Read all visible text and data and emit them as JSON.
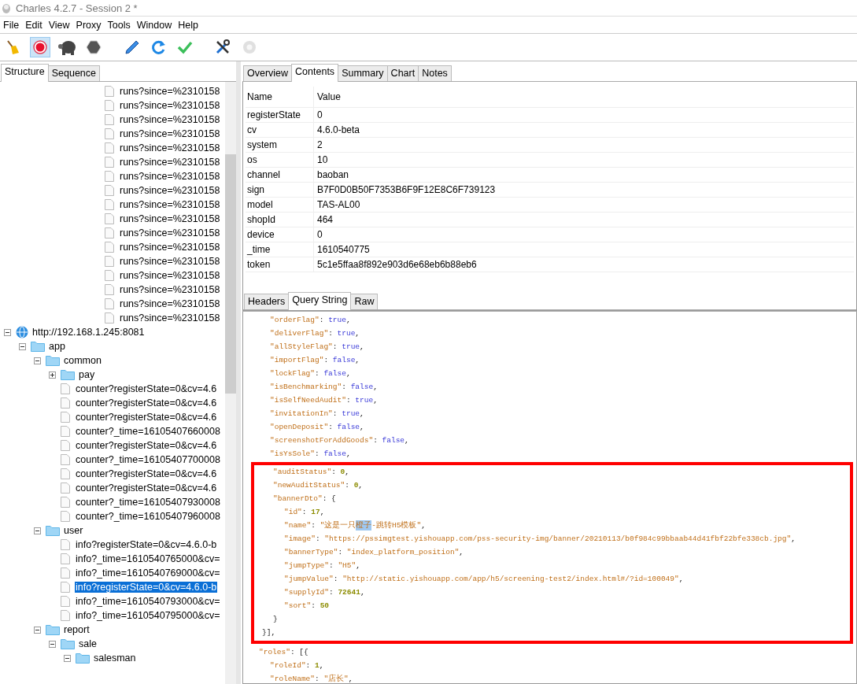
{
  "window": {
    "title": "Charles 4.2.7 - Session 2 *"
  },
  "menu": [
    "File",
    "Edit",
    "View",
    "Proxy",
    "Tools",
    "Window",
    "Help"
  ],
  "toolbar": [
    {
      "kind": "broom",
      "pressed": false,
      "disabled": false
    },
    {
      "kind": "record",
      "pressed": true,
      "disabled": false
    },
    {
      "kind": "turtle",
      "pressed": false,
      "disabled": false
    },
    {
      "kind": "stop",
      "pressed": false,
      "disabled": false
    },
    {
      "kind": "pen",
      "pressed": false,
      "disabled": false
    },
    {
      "kind": "refresh",
      "pressed": false,
      "disabled": false
    },
    {
      "kind": "check",
      "pressed": false,
      "disabled": false
    },
    {
      "kind": "tools",
      "pressed": false,
      "disabled": false
    },
    {
      "kind": "gear",
      "pressed": false,
      "disabled": true
    }
  ],
  "left_tabs": [
    {
      "label": "Structure",
      "selected": true
    },
    {
      "label": "Sequence",
      "selected": false
    }
  ],
  "tree": {
    "scrolled_rows": [
      {
        "label": "runs?since=%2310158",
        "selected": false
      },
      {
        "label": "runs?since=%2310158",
        "selected": false
      },
      {
        "label": "runs?since=%2310158",
        "selected": false
      },
      {
        "label": "runs?since=%2310158",
        "selected": false
      },
      {
        "label": "runs?since=%2310158",
        "selected": false
      },
      {
        "label": "runs?since=%2310158",
        "selected": false
      },
      {
        "label": "runs?since=%2310158",
        "selected": false
      },
      {
        "label": "runs?since=%2310158",
        "selected": false
      },
      {
        "label": "runs?since=%2310158",
        "selected": false
      },
      {
        "label": "runs?since=%2310158",
        "selected": false
      },
      {
        "label": "runs?since=%2310158",
        "selected": false
      },
      {
        "label": "runs?since=%2310158",
        "selected": false
      },
      {
        "label": "runs?since=%2310158",
        "selected": false
      },
      {
        "label": "runs?since=%2310158",
        "selected": false
      },
      {
        "label": "runs?since=%2310158",
        "selected": false
      },
      {
        "label": "runs?since=%2310158",
        "selected": false
      },
      {
        "label": "runs?since=%2310158",
        "selected": false
      }
    ],
    "nodes": [
      {
        "kind": "host",
        "label": "http://192.168.1.245:8081",
        "expanded": true,
        "selected": false,
        "children": [
          {
            "kind": "folder",
            "label": "app",
            "expanded": true,
            "selected": false,
            "children": [
              {
                "kind": "folder",
                "label": "common",
                "expanded": true,
                "selected": false,
                "children": [
                  {
                    "kind": "folder",
                    "label": "pay",
                    "expanded": false,
                    "selected": false
                  },
                  {
                    "kind": "file",
                    "label": "counter?registerState=0&cv=4.6",
                    "selected": false
                  },
                  {
                    "kind": "file",
                    "label": "counter?registerState=0&cv=4.6",
                    "selected": false
                  },
                  {
                    "kind": "file",
                    "label": "counter?registerState=0&cv=4.6",
                    "selected": false
                  },
                  {
                    "kind": "file",
                    "label": "counter?_time=16105407660008",
                    "selected": false
                  },
                  {
                    "kind": "file",
                    "label": "counter?registerState=0&cv=4.6",
                    "selected": false
                  },
                  {
                    "kind": "file",
                    "label": "counter?_time=16105407700008",
                    "selected": false
                  },
                  {
                    "kind": "file",
                    "label": "counter?registerState=0&cv=4.6",
                    "selected": false
                  },
                  {
                    "kind": "file",
                    "label": "counter?registerState=0&cv=4.6",
                    "selected": false
                  },
                  {
                    "kind": "file",
                    "label": "counter?_time=16105407930008",
                    "selected": false
                  },
                  {
                    "kind": "file",
                    "label": "counter?_time=16105407960008",
                    "selected": false
                  }
                ]
              },
              {
                "kind": "folder",
                "label": "user",
                "expanded": true,
                "selected": false,
                "children": [
                  {
                    "kind": "file",
                    "label": "info?registerState=0&cv=4.6.0-b",
                    "selected": false
                  },
                  {
                    "kind": "file",
                    "label": "info?_time=1610540765000&cv=",
                    "selected": false
                  },
                  {
                    "kind": "file",
                    "label": "info?_time=1610540769000&cv=",
                    "selected": false
                  },
                  {
                    "kind": "file",
                    "label": "info?registerState=0&cv=4.6.0-b",
                    "selected": true
                  },
                  {
                    "kind": "file",
                    "label": "info?_time=1610540793000&cv=",
                    "selected": false
                  },
                  {
                    "kind": "file",
                    "label": "info?_time=1610540795000&cv=",
                    "selected": false
                  }
                ]
              },
              {
                "kind": "folder",
                "label": "report",
                "expanded": true,
                "selected": false,
                "children": [
                  {
                    "kind": "folder",
                    "label": "sale",
                    "expanded": true,
                    "selected": false,
                    "children": [
                      {
                        "kind": "folder",
                        "label": "salesman",
                        "expanded": true,
                        "selected": false
                      }
                    ]
                  }
                ]
              }
            ]
          }
        ]
      }
    ]
  },
  "top_tabs": [
    {
      "label": "Overview",
      "selected": false
    },
    {
      "label": "Contents",
      "selected": true
    },
    {
      "label": "Summary",
      "selected": false
    },
    {
      "label": "Chart",
      "selected": false
    },
    {
      "label": "Notes",
      "selected": false
    }
  ],
  "table": {
    "columns": [
      "Name",
      "Value"
    ],
    "rows": [
      [
        "registerState",
        "0"
      ],
      [
        "cv",
        "4.6.0-beta"
      ],
      [
        "system",
        "2"
      ],
      [
        "os",
        "10"
      ],
      [
        "channel",
        "baoban"
      ],
      [
        "sign",
        "B7F0D0B50F7353B6F9F12E8C6F739123"
      ],
      [
        "model",
        "TAS-AL00"
      ],
      [
        "shopId",
        "464"
      ],
      [
        "device",
        "0"
      ],
      [
        "_time",
        "1610540775"
      ],
      [
        "token",
        "5c1e5ffaa8f892e903d6e68eb6b88eb6"
      ]
    ]
  },
  "bottom_tabs": [
    {
      "label": "Headers",
      "selected": false
    },
    {
      "label": "Query String",
      "selected": true
    },
    {
      "label": "Raw",
      "selected": false
    }
  ],
  "code": {
    "lines_before": [
      {
        "children": [
          {
            "parts": [
              {
                "kind": "key",
                "text": "\"orderFlag\""
              },
              {
                "kind": "punct",
                "text": ": "
              },
              {
                "kind": "bool",
                "text": "true"
              },
              {
                "kind": "punct",
                "text": ","
              }
            ]
          },
          {
            "parts": [
              {
                "kind": "key",
                "text": "\"deliverFlag\""
              },
              {
                "kind": "punct",
                "text": ": "
              },
              {
                "kind": "bool",
                "text": "true"
              },
              {
                "kind": "punct",
                "text": ","
              }
            ]
          },
          {
            "parts": [
              {
                "kind": "key",
                "text": "\"allStyleFlag\""
              },
              {
                "kind": "punct",
                "text": ": "
              },
              {
                "kind": "bool",
                "text": "true"
              },
              {
                "kind": "punct",
                "text": ","
              }
            ]
          },
          {
            "parts": [
              {
                "kind": "key",
                "text": "\"importFlag\""
              },
              {
                "kind": "punct",
                "text": ": "
              },
              {
                "kind": "bool",
                "text": "false"
              },
              {
                "kind": "punct",
                "text": ","
              }
            ]
          },
          {
            "parts": [
              {
                "kind": "key",
                "text": "\"lockFlag\""
              },
              {
                "kind": "punct",
                "text": ": "
              },
              {
                "kind": "bool",
                "text": "false"
              },
              {
                "kind": "punct",
                "text": ","
              }
            ]
          },
          {
            "parts": [
              {
                "kind": "key",
                "text": "\"isBenchmarking\""
              },
              {
                "kind": "punct",
                "text": ": "
              },
              {
                "kind": "bool",
                "text": "false"
              },
              {
                "kind": "punct",
                "text": ","
              }
            ]
          },
          {
            "parts": [
              {
                "kind": "key",
                "text": "\"isSelfNeedAudit\""
              },
              {
                "kind": "punct",
                "text": ": "
              },
              {
                "kind": "bool",
                "text": "true"
              },
              {
                "kind": "punct",
                "text": ","
              }
            ]
          },
          {
            "parts": [
              {
                "kind": "key",
                "text": "\"invitationIn\""
              },
              {
                "kind": "punct",
                "text": ": "
              },
              {
                "kind": "bool",
                "text": "true"
              },
              {
                "kind": "punct",
                "text": ","
              }
            ]
          },
          {
            "parts": [
              {
                "kind": "key",
                "text": "\"openDeposit\""
              },
              {
                "kind": "punct",
                "text": ": "
              },
              {
                "kind": "bool",
                "text": "false"
              },
              {
                "kind": "punct",
                "text": ","
              }
            ]
          },
          {
            "parts": [
              {
                "kind": "key",
                "text": "\"screenshotForAddGoods\""
              },
              {
                "kind": "punct",
                "text": ": "
              },
              {
                "kind": "bool",
                "text": "false"
              },
              {
                "kind": "punct",
                "text": ","
              }
            ]
          },
          {
            "parts": [
              {
                "kind": "key",
                "text": "\"isYsSole\""
              },
              {
                "kind": "punct",
                "text": ": "
              },
              {
                "kind": "bool",
                "text": "false"
              },
              {
                "kind": "punct",
                "text": ","
              }
            ]
          }
        ]
      }
    ],
    "highlight_box": [
      {
        "children": [
          {
            "parts": [
              {
                "kind": "key",
                "text": "\"auditStatus\""
              },
              {
                "kind": "punct",
                "text": ": "
              },
              {
                "kind": "number",
                "text": "0"
              },
              {
                "kind": "punct",
                "text": ","
              }
            ]
          },
          {
            "parts": [
              {
                "kind": "key",
                "text": "\"newAuditStatus\""
              },
              {
                "kind": "punct",
                "text": ": "
              },
              {
                "kind": "number",
                "text": "0"
              },
              {
                "kind": "punct",
                "text": ","
              }
            ]
          },
          {
            "parts": [
              {
                "kind": "key",
                "text": "\"bannerDto\""
              },
              {
                "kind": "punct",
                "text": ": {"
              }
            ],
            "children": [
              {
                "parts": [
                  {
                    "kind": "key",
                    "text": "\"id\""
                  },
                  {
                    "kind": "punct",
                    "text": ": "
                  },
                  {
                    "kind": "number",
                    "text": "17"
                  },
                  {
                    "kind": "punct",
                    "text": ","
                  }
                ]
              },
              {
                "parts": [
                  {
                    "kind": "key",
                    "text": "\"name\""
                  },
                  {
                    "kind": "punct",
                    "text": ": "
                  },
                  {
                    "kind": "string",
                    "text": "\"这是一只"
                  },
                  {
                    "kind": "match",
                    "text": "橙子"
                  },
                  {
                    "kind": "string",
                    "text": "-跳转H5模板\""
                  },
                  {
                    "kind": "punct",
                    "text": ","
                  }
                ]
              },
              {
                "parts": [
                  {
                    "kind": "key",
                    "text": "\"image\""
                  },
                  {
                    "kind": "punct",
                    "text": ": "
                  },
                  {
                    "kind": "string",
                    "text": "\"https://pssimgtest.yishouapp.com/pss-security-img/banner/20210113/b0f984c99bbaab44d41fbf22bfe338cb.jpg\""
                  },
                  {
                    "kind": "punct",
                    "text": ","
                  }
                ]
              },
              {
                "parts": [
                  {
                    "kind": "key",
                    "text": "\"bannerType\""
                  },
                  {
                    "kind": "punct",
                    "text": ": "
                  },
                  {
                    "kind": "string",
                    "text": "\"index_platform_position\""
                  },
                  {
                    "kind": "punct",
                    "text": ","
                  }
                ]
              },
              {
                "parts": [
                  {
                    "kind": "key",
                    "text": "\"jumpType\""
                  },
                  {
                    "kind": "punct",
                    "text": ": "
                  },
                  {
                    "kind": "string",
                    "text": "\"H5\""
                  },
                  {
                    "kind": "punct",
                    "text": ","
                  }
                ]
              },
              {
                "parts": [
                  {
                    "kind": "key",
                    "text": "\"jumpValue\""
                  },
                  {
                    "kind": "punct",
                    "text": ": "
                  },
                  {
                    "kind": "string",
                    "text": "\"http://static.yishouapp.com/app/h5/screening-test2/index.html#/?id=100049\""
                  },
                  {
                    "kind": "punct",
                    "text": ","
                  }
                ]
              },
              {
                "parts": [
                  {
                    "kind": "key",
                    "text": "\"supplyId\""
                  },
                  {
                    "kind": "punct",
                    "text": ": "
                  },
                  {
                    "kind": "number",
                    "text": "72641"
                  },
                  {
                    "kind": "punct",
                    "text": ","
                  }
                ]
              },
              {
                "parts": [
                  {
                    "kind": "key",
                    "text": "\"sort\""
                  },
                  {
                    "kind": "punct",
                    "text": ": "
                  },
                  {
                    "kind": "number",
                    "text": "50"
                  }
                ]
              }
            ]
          },
          {
            "parts": [
              {
                "kind": "punct",
                "text": "}"
              }
            ]
          }
        ]
      },
      {
        "parts": [
          {
            "kind": "punct",
            "text": "}],"
          }
        ]
      }
    ],
    "lines_after": [
      {
        "parts": [
          {
            "kind": "key",
            "text": "\"roles\""
          },
          {
            "kind": "punct",
            "text": ": [{"
          }
        ],
        "children": [
          {
            "parts": [
              {
                "kind": "key",
                "text": "\"roleId\""
              },
              {
                "kind": "punct",
                "text": ": "
              },
              {
                "kind": "number",
                "text": "1"
              },
              {
                "kind": "punct",
                "text": ","
              }
            ]
          },
          {
            "parts": [
              {
                "kind": "key",
                "text": "\"roleName\""
              },
              {
                "kind": "punct",
                "text": ": "
              },
              {
                "kind": "string",
                "text": "\"店长\""
              },
              {
                "kind": "punct",
                "text": ","
              }
            ]
          }
        ]
      }
    ]
  }
}
